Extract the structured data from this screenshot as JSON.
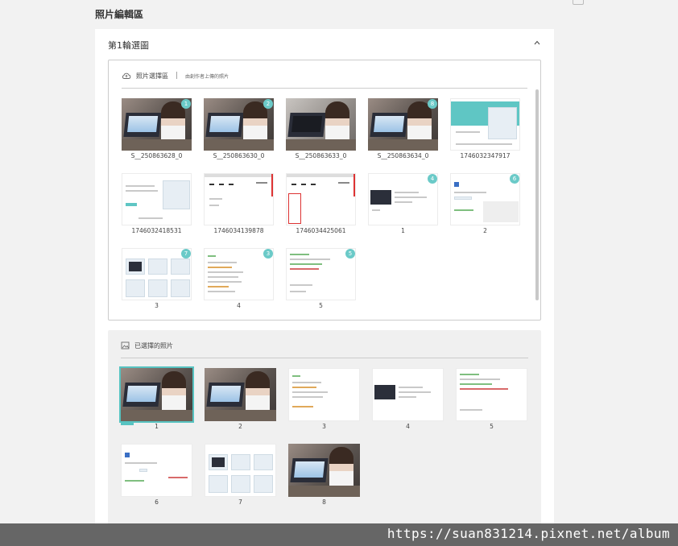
{
  "page": {
    "title": "照片編輯區"
  },
  "round": {
    "title": "第1輪選圖"
  },
  "source": {
    "label": "照片選擇區",
    "separator": "|",
    "subtitle": "由創作者上傳的照片",
    "photos": [
      {
        "label": "S__250863628_0",
        "badge": "1"
      },
      {
        "label": "S__250863630_0",
        "badge": "2"
      },
      {
        "label": "S__250863633_0",
        "badge": ""
      },
      {
        "label": "S__250863634_0",
        "badge": "8"
      },
      {
        "label": "1746032347917",
        "badge": ""
      },
      {
        "label": "1746032418531",
        "badge": ""
      },
      {
        "label": "1746034139878",
        "badge": ""
      },
      {
        "label": "1746034425061",
        "badge": ""
      },
      {
        "label": "1",
        "badge": "4"
      },
      {
        "label": "2",
        "badge": "6"
      },
      {
        "label": "3",
        "badge": "7"
      },
      {
        "label": "4",
        "badge": "3"
      },
      {
        "label": "5",
        "badge": "5"
      }
    ]
  },
  "selected": {
    "label": "已選擇的照片",
    "photos": [
      {
        "label": "1"
      },
      {
        "label": "2"
      },
      {
        "label": "3"
      },
      {
        "label": "4"
      },
      {
        "label": "5"
      },
      {
        "label": "6"
      },
      {
        "label": "7"
      },
      {
        "label": "8"
      }
    ]
  },
  "watermark": "https://suan831214.pixnet.net/album",
  "colors": {
    "accent": "#6bcac8",
    "panel_border": "#cccccc",
    "footer": "#666666"
  },
  "icons": {
    "upload": "cloud-upload-icon",
    "gallery": "image-icon",
    "collapse": "chevron-up-icon",
    "comment": "comment-icon"
  }
}
